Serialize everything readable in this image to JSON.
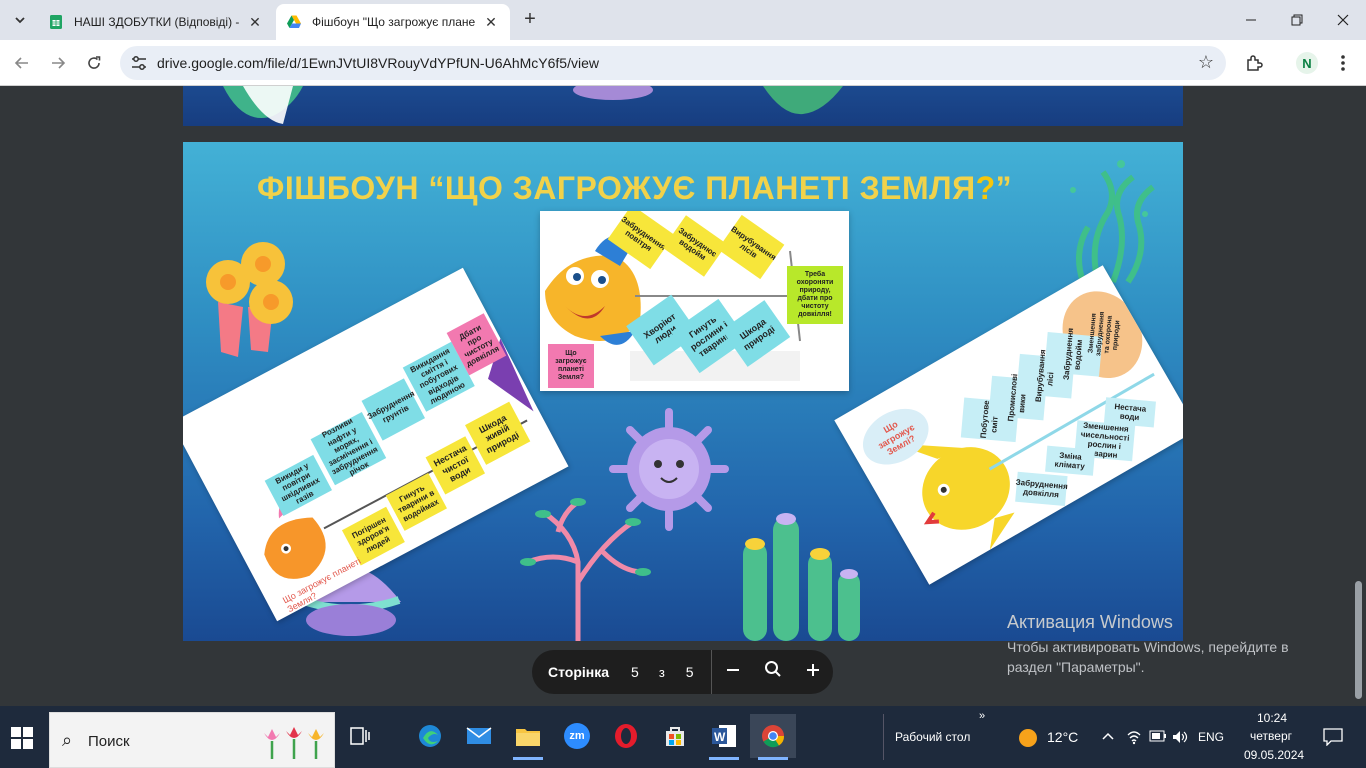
{
  "browser": {
    "tabs": [
      {
        "title": "НАШІ ЗДОБУТКИ (Відповіді) - ",
        "active": false
      },
      {
        "title": "Фішбоун \"Що загрожує плане",
        "active": true
      }
    ],
    "url": "drive.google.com/file/d/1EwnJVtUI8VRouyVdYPfUN-U6AhMcY6f5/view",
    "profile_initial": "N"
  },
  "slide": {
    "title_prefix": "ФІШБОУН “ЩО ЗАГРОЖУЄ ПЛАНЕТІ ЗЕМЛЯ",
    "title_q": "?",
    "title_suffix": "”",
    "left_card": {
      "stickies": [
        "Викиди у повітри шкідливих газів",
        "Розливи нафти у морях, засмічення і забруднення річок",
        "Забруднення грунтів",
        "Викидання сміття і побутових відходів людиною",
        "Дбати про чистоту довкілля",
        "Погіршен здоров'я людей",
        "Гинуть тварини в водоймах",
        "Нестача чистої води",
        "Шкода живій природі"
      ],
      "caption": "Що загрожує планеті Земля?"
    },
    "center_card": {
      "stickies": [
        "Забруднення повітря",
        "Забруднює водойм",
        "Вирубування лісів",
        "Треба охороняти природу, дбати про чистоту довкілля!",
        "Хворіют люди",
        "Гинуть рослини і тварини",
        "Шкода природі",
        "Що загрожує планеті Земля?"
      ]
    },
    "right_card": {
      "stickies": [
        "Що загрожує Землі?",
        "Побутове сміття",
        "Промислові викиди",
        "Вирубування лісів",
        "Забруднення водойм",
        "Зменшення забруднення та охорона природи",
        "Нестача води",
        "Зменшення чисельності рослин і тварин",
        "Зміна клімату",
        "Забруднення довкілля"
      ]
    }
  },
  "pager": {
    "label": "Сторінка",
    "current": "5",
    "of": "з",
    "total": "5"
  },
  "activation": {
    "title": "Активация Windows",
    "message": "Чтобы активировать Windows, перейдите в раздел \"Параметры\"."
  },
  "taskbar": {
    "search_placeholder": "Поиск",
    "desktop_label": "Рабочий стол",
    "temperature": "12°C",
    "language": "ENG",
    "time": "10:24",
    "weekday": "четверг",
    "date": "09.05.2024"
  },
  "colors": {
    "title_yellow": "#f1d24a",
    "sticky_yellow": "#f7e63a",
    "sticky_cyan": "#7fdde6",
    "sticky_pink": "#f279b0",
    "sticky_green": "#b8e82a",
    "sticky_orange": "#f6c38a"
  }
}
